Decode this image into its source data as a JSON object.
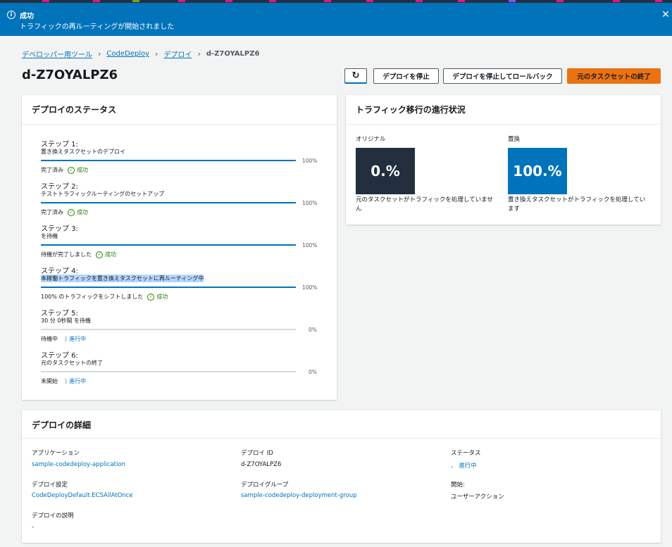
{
  "flash": {
    "title": "成功",
    "message": "トラフィックの再ルーティングが開始されました"
  },
  "breadcrumb": [
    "デベロッパー用ツール",
    "CodeDeploy",
    "デプロイ",
    "d-Z7OYALPZ6"
  ],
  "page_title": "d-Z7OYALPZ6",
  "actions": {
    "stop": "デプロイを停止",
    "stop_rollback": "デプロイを停止してロールバック",
    "terminate": "元のタスクセットの終了"
  },
  "status_panel": {
    "title": "デプロイのステータス",
    "steps": [
      {
        "title": "ステップ 1:",
        "desc": "置き換えタスクセットのデプロイ",
        "progress": 100,
        "pct_label": "100%",
        "status_text": "完了済み",
        "badge": "成功",
        "badge_type": "success"
      },
      {
        "title": "ステップ 2:",
        "desc": "テストトラフィックルーティングのセットアップ",
        "progress": 100,
        "pct_label": "100%",
        "status_text": "完了済み",
        "badge": "成功",
        "badge_type": "success"
      },
      {
        "title": "ステップ 3:",
        "desc": "を待機",
        "progress": 100,
        "pct_label": "100%",
        "status_text": "待機が完了しました",
        "badge": "成功",
        "badge_type": "success"
      },
      {
        "title": "ステップ 4:",
        "desc": "本稼働トラフィックを置き換えタスクセットに再ルーティング中",
        "progress": 100,
        "pct_label": "100%",
        "status_text": "100% のトラフィックをシフトしました",
        "badge": "成功",
        "badge_type": "success"
      },
      {
        "title": "ステップ 5:",
        "desc": "30 分 0秒間 を待機",
        "progress": 0,
        "pct_label": "0%",
        "status_text": "待機中",
        "badge": "進行中",
        "badge_type": "progress"
      },
      {
        "title": "ステップ 6:",
        "desc": "元のタスクセットの終了",
        "progress": 0,
        "pct_label": "0%",
        "status_text": "未開始",
        "badge": "進行中",
        "badge_type": "progress"
      }
    ]
  },
  "traffic_panel": {
    "title": "トラフィック移行の進行状況",
    "original": {
      "label": "オリジナル",
      "value": "0.%",
      "desc": "元のタスクセットがトラフィックを処理していません",
      "color": "#232f3e"
    },
    "replacement": {
      "label": "置換",
      "value": "100.%",
      "desc": "置き換えタスクセットがトラフィックを処理しています",
      "color": "#0073bb"
    }
  },
  "details_panel": {
    "title": "デプロイの詳細",
    "application_label": "アプリケーション",
    "application_value": "sample-codedeploy-application",
    "deployment_id_label": "デプロイ ID",
    "deployment_id_value": "d-Z7OYALPZ6",
    "status_label": "ステータス",
    "status_value": "進行中",
    "config_label": "デプロイ設定",
    "config_value": "CodeDeployDefault.ECSAllAtOnce",
    "group_label": "デプロイグループ",
    "group_value": "sample-codedeploy-deployment-group",
    "start_label": "開始:",
    "start_value": "ユーザーアクション",
    "desc_label": "デプロイの説明",
    "desc_value": "-"
  },
  "colors": {
    "accent": "#0073bb",
    "primary_button": "#ec7211",
    "success": "#1d8102",
    "dark_box": "#232f3e"
  }
}
